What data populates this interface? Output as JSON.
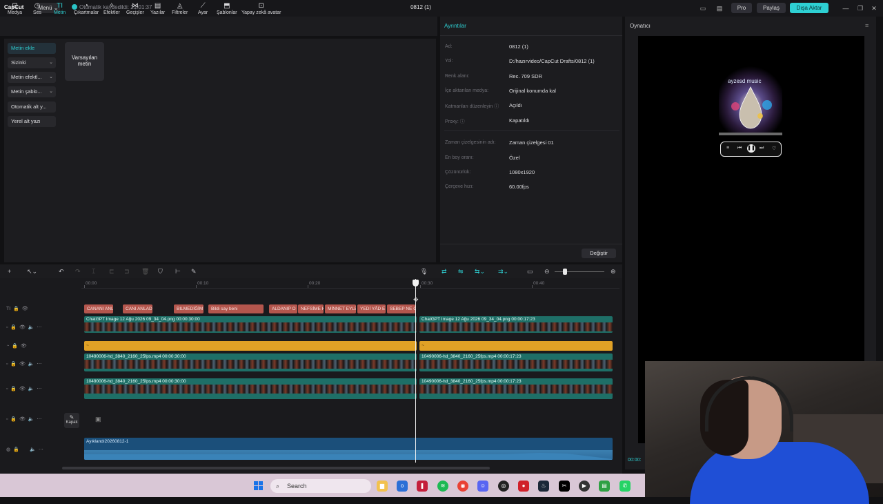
{
  "titlebar": {
    "logo": "CapCut",
    "menu_label": "Menü ⌄",
    "autosave": "Otomatik kaydedildi: 21:01:37",
    "doc_title": "0812 (1)",
    "pro_label": "Pro",
    "share_label": "Paylaş",
    "export_label": "Dışa Aktar"
  },
  "toolbar": {
    "items": [
      {
        "label": "Medya",
        "icon": "media-icon"
      },
      {
        "label": "Ses",
        "icon": "audio-icon"
      },
      {
        "label": "Metin",
        "icon": "text-icon",
        "active": true
      },
      {
        "label": "Çıkartmalar",
        "icon": "sticker-icon"
      },
      {
        "label": "Efektler",
        "icon": "effects-icon"
      },
      {
        "label": "Geçişler",
        "icon": "transitions-icon"
      },
      {
        "label": "Yazılar",
        "icon": "captions-icon"
      },
      {
        "label": "Filtreler",
        "icon": "filters-icon"
      },
      {
        "label": "Ayar",
        "icon": "adjust-icon"
      },
      {
        "label": "Şablonlar",
        "icon": "templates-icon"
      },
      {
        "label": "Yapay zekâ avatar",
        "icon": "ai-avatar-icon"
      }
    ]
  },
  "leftpanel": {
    "items": [
      {
        "label": "Metin ekle",
        "active": true
      },
      {
        "label": "Sizinki",
        "chevron": true
      },
      {
        "label": "Metin efektl...",
        "chevron": true
      },
      {
        "label": "Metin şablo...",
        "chevron": true
      },
      {
        "label": "Otomatik alt y..."
      },
      {
        "label": "Yerel alt yazı"
      }
    ],
    "default_text_card": "Varsayılan metin"
  },
  "details": {
    "title": "Ayrıntılar",
    "rows": [
      {
        "label": "Ad:",
        "value": "0812 (1)"
      },
      {
        "label": "Yol:",
        "value": "D:/hazırvideo/CapCut Drafts/0812 (1)"
      },
      {
        "label": "Renk alanı:",
        "value": "Rec. 709 SDR"
      },
      {
        "label": "İçe aktarılan medya:",
        "value": "Orijinal konumda kal"
      },
      {
        "label": "Katmanları düzenleyin ⓘ",
        "value": "Açıldı"
      },
      {
        "label": "Proxy: ⓘ",
        "value": "Kapatıldı"
      }
    ],
    "rows2": [
      {
        "label": "Zaman çizelgesinin adı:",
        "value": "Zaman çizelgesi 01"
      },
      {
        "label": "En boy oranı:",
        "value": "Özel"
      },
      {
        "label": "Çözünürlük:",
        "value": "1080x1920"
      },
      {
        "label": "Çerçeve hızı:",
        "value": "60.00fps"
      }
    ],
    "change_button": "Değiştir"
  },
  "player": {
    "title": "Oynatıcı",
    "music_label": "ayzesd music",
    "time": "00:00:"
  },
  "timeline": {
    "ruler": [
      "00:00",
      "00:10",
      "00:20",
      "00:30",
      "00:40"
    ],
    "text_clips": [
      "CANANI ANL",
      "CANI ANLAD",
      "BILMEDİĞİM",
      "Bildi say beni",
      "ALDANIP O",
      "NEFSİME K",
      "MİNNET EYLE",
      "YEDİ YÂD E",
      "SEBEP NE O"
    ],
    "image_clip_1": "ChatGPT Image 12 Ağu 2026 09_34_04.png  00:00:30:00",
    "image_clip_2": "ChatGPT Image 12 Ağu 2026 09_34_04.png  00:00:17:23",
    "video_clip_a1": "10490006-hd_3840_2160_25fps.mp4  00:00:30:00",
    "video_clip_a2": "10490006-hd_3840_2160_25fps.mp4  00:00:17:23",
    "video_clip_b1": "10490006-hd_3840_2160_25fps.mp4  00:00:30:00",
    "video_clip_b2": "10490006-hd_3840_2160_25fps.mp4  00:00:17:23",
    "cover_label": "Kapak",
    "audio_clip": "Ayıklandı20260812-1"
  },
  "taskbar": {
    "search_placeholder": "Search"
  }
}
